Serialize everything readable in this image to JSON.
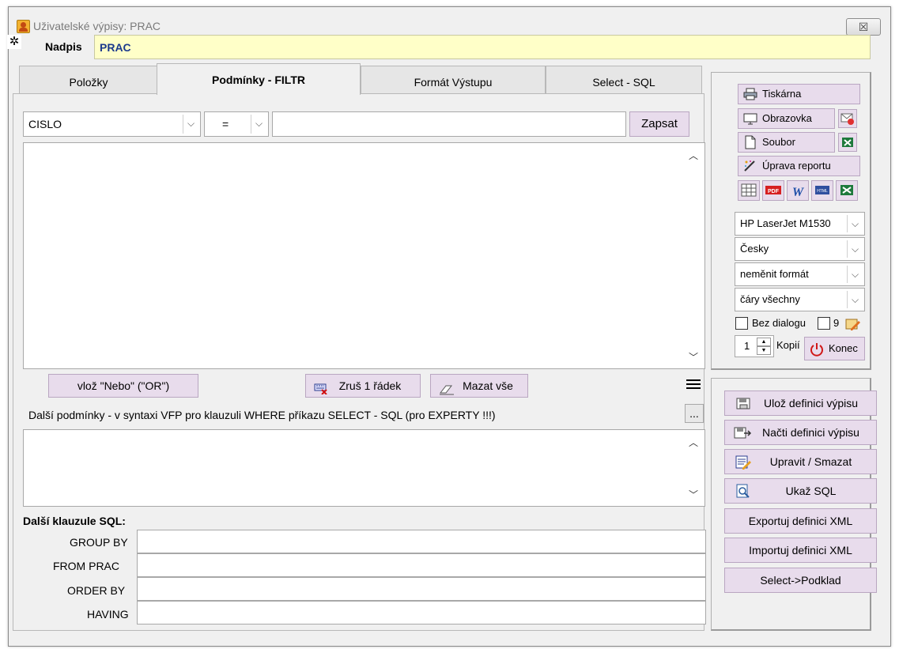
{
  "window": {
    "title": "Uživatelské výpisy: PRAC",
    "close_label": "☒"
  },
  "header": {
    "nadpis_label": "Nadpis",
    "nadpis_value": "PRAC"
  },
  "tabs": [
    {
      "label": "Položky"
    },
    {
      "label": "Podmínky - FILTR"
    },
    {
      "label": "Formát Výstupu"
    },
    {
      "label": "Select - SQL"
    }
  ],
  "filter": {
    "field_value": "CISLO",
    "operator_value": "=",
    "value_input": "",
    "write_button": "Zapsat"
  },
  "conditions": {
    "or_button": "vlož \"Nebo\" (\"OR\")",
    "remove_row_button": "Zruš 1 řádek",
    "clear_all_button": "Mazat vše",
    "more_conditions_label": "Další podmínky - v syntaxi VFP pro klauzuli WHERE příkazu SELECT - SQL (pro EXPERTY !!!)",
    "ellipsis_button": "..."
  },
  "sql": {
    "section_label": "Další klauzule SQL:",
    "group_by_label": "GROUP BY",
    "from_label": "FROM PRAC",
    "order_by_label": "ORDER BY",
    "having_label": "HAVING",
    "group_by_value": "",
    "from_value": "",
    "order_by_value": "",
    "having_value": ""
  },
  "output": {
    "printer_button": "Tiskárna",
    "screen_button": "Obrazovka",
    "file_button": "Soubor",
    "edit_report_button": "Úprava reportu",
    "printer_select": "HP LaserJet M1530",
    "language_select": "Česky",
    "format_select": "neměnit formát",
    "lines_select": "čáry všechny",
    "no_dialog_label": "Bez dialogu",
    "nine_label": "9",
    "copies_value": "1",
    "copies_label": "Kopií",
    "exit_button": "Konec"
  },
  "actions": {
    "save_definition": "Ulož definici výpisu",
    "load_definition": "Načti definici výpisu",
    "edit_delete": "Upravit / Smazat",
    "show_sql": "Ukaž SQL",
    "export_xml": "Exportuj definici XML",
    "import_xml": "Importuj definici XML",
    "select_to_base": "Select->Podklad"
  },
  "colors": {
    "button_bg": "#e8dcec",
    "nadpis_bg": "#ffffc8",
    "nadpis_text": "#1c3a8c"
  }
}
